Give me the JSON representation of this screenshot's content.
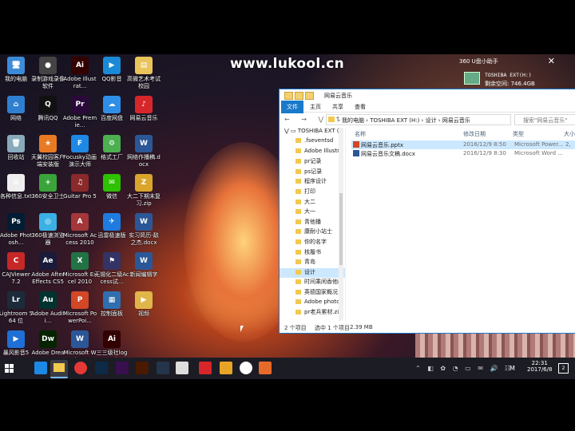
{
  "watermark": "www.lukool.cn",
  "notification": {
    "title": "360 U盘小助手",
    "close": "✕",
    "device": "TOSHIBA EXT(H:)",
    "space": "剩余空间: 746.4GB"
  },
  "desktop_icons": [
    {
      "label": "我的电脑",
      "color": "#3c8bd8",
      "glyph": "🖥"
    },
    {
      "label": "录制游戏录像软件",
      "color": "#444",
      "glyph": "●"
    },
    {
      "label": "Adobe Illustrat...",
      "color": "#330000",
      "glyph": "Ai"
    },
    {
      "label": "QQ影音",
      "color": "#1b8ad6",
      "glyph": "▶"
    },
    {
      "label": "高微艺术考试校园",
      "color": "#e8c45a",
      "glyph": "▤"
    },
    {
      "label": "网络",
      "color": "#2f7fd0",
      "glyph": "⌂"
    },
    {
      "label": "腾讯QQ",
      "color": "#111",
      "glyph": "Q"
    },
    {
      "label": "Adobe Premie...",
      "color": "#2a0a3a",
      "glyph": "Pr"
    },
    {
      "label": "百度网盘",
      "color": "#2f8ee8",
      "glyph": "☁"
    },
    {
      "label": "网易云音乐",
      "color": "#d7262a",
      "glyph": "♪"
    },
    {
      "label": "回收站",
      "color": "#8ab",
      "glyph": "🗑"
    },
    {
      "label": "天翼校园客户端安装版",
      "color": "#e97a24",
      "glyph": "★"
    },
    {
      "label": "Focusky动画演示大师",
      "color": "#1e88e5",
      "glyph": "F"
    },
    {
      "label": "格式工厂",
      "color": "#4caf50",
      "glyph": "⚙"
    },
    {
      "label": "网络作播稿.docx",
      "color": "#2b5797",
      "glyph": "W"
    },
    {
      "label": "各种信息.txt",
      "color": "#eee",
      "glyph": "≡"
    },
    {
      "label": "360安全卫士",
      "color": "#3aa33a",
      "glyph": "+"
    },
    {
      "label": "Guitar Pro 5",
      "color": "#8a2a2a",
      "glyph": "♫"
    },
    {
      "label": "微信",
      "color": "#2dc100",
      "glyph": "✉"
    },
    {
      "label": "大二下期末复习.zip",
      "color": "#d9a52b",
      "glyph": "Z"
    },
    {
      "label": "Adobe Photosh...",
      "color": "#001d34",
      "glyph": "Ps"
    },
    {
      "label": "360极速浏览器",
      "color": "#3bb0e4",
      "glyph": "◎"
    },
    {
      "label": "Microsoft Access 2010",
      "color": "#a4373a",
      "glyph": "A"
    },
    {
      "label": "迅雷极速版",
      "color": "#1e7be0",
      "glyph": "✈"
    },
    {
      "label": "实习简历-敌之杰.docx",
      "color": "#2b5797",
      "glyph": "W"
    },
    {
      "label": "CAJViewer 7.2",
      "color": "#c62828",
      "glyph": "C"
    },
    {
      "label": "Adobe After Effects CS5",
      "color": "#1a1a3a",
      "glyph": "Ae"
    },
    {
      "label": "Microsoft Excel 2010",
      "color": "#217346",
      "glyph": "X"
    },
    {
      "label": "无锡化二级Access试...",
      "color": "#336",
      "glyph": "⚑"
    },
    {
      "label": "新闻编辑字",
      "color": "#2b5797",
      "glyph": "W"
    },
    {
      "label": "Lightroom 5 64 位",
      "color": "#1c2b3a",
      "glyph": "Lr"
    },
    {
      "label": "Adobe Auditi...",
      "color": "#00332f",
      "glyph": "Au"
    },
    {
      "label": "Microsoft PowerPoi...",
      "color": "#d24726",
      "glyph": "P"
    },
    {
      "label": "控制面板",
      "color": "#2f6fb0",
      "glyph": "▦"
    },
    {
      "label": "视频",
      "color": "#e0b64a",
      "glyph": "▶"
    },
    {
      "label": "暴风影音5",
      "color": "#1e6fd6",
      "glyph": "▶"
    },
    {
      "label": "Adobe Dreamwe...",
      "color": "#072401",
      "glyph": "Dw"
    },
    {
      "label": "Microsoft Word 2010",
      "color": "#2b5797",
      "glyph": "W"
    },
    {
      "label": "三三级社logo.ai",
      "color": "#330000",
      "glyph": "Ai"
    }
  ],
  "explorer": {
    "title": "网易云音乐",
    "ribbon": {
      "file": "文件",
      "home": "主页",
      "share": "共享",
      "view": "查看"
    },
    "nav_arrows": "← → ⋁ ↑",
    "breadcrumb": "› 我的电脑 › TOSHIBA EXT (H:) › 设计 › 网易云音乐",
    "search_placeholder": "搜索\"网易云音乐\"",
    "nav_root": "TOSHIBA EXT (",
    "nav_items": [
      ".fseventsd",
      "Adobe Illustr",
      "pr记录",
      "ps记录",
      "程序设计",
      "打印",
      "大二",
      "大一",
      "青他播",
      "康耐小站士",
      "你的名字",
      "核履书",
      "青岛",
      "设计",
      "时间乘闲香他画",
      "英德国家概况",
      "Adobe photo",
      "pr老兵累材.zip"
    ],
    "selected_nav": "设计",
    "columns": {
      "name": "名称",
      "date": "修改日期",
      "type": "类型",
      "size": "大小"
    },
    "files": [
      {
        "name": "网易云音乐.pptx",
        "date": "2016/12/9 8:50",
        "type": "Microsoft Power...",
        "size": "2,",
        "color": "#d24726"
      },
      {
        "name": "网易云音乐文稿.docx",
        "date": "2016/12/9 8:30",
        "type": "Microsoft Word ...",
        "size": "",
        "color": "#2b5797"
      }
    ],
    "status": {
      "count": "2 个项目",
      "selected": "选中 1 个项目",
      "size": "2.39 MB"
    }
  },
  "taskbar": {
    "apps": [
      {
        "name": "edge",
        "color": "#1e88e5"
      },
      {
        "name": "explorer",
        "color": "#f1c94f",
        "active": true
      },
      {
        "name": "chrome-like",
        "color": "#e53935"
      },
      {
        "name": "photoshop",
        "color": "#0d2a47"
      },
      {
        "name": "premiere",
        "color": "#3a0f4f"
      },
      {
        "name": "illustrator",
        "color": "#4a1a00"
      },
      {
        "name": "lightroom",
        "color": "#24344a"
      },
      {
        "name": "qq",
        "color": "#ddd"
      },
      {
        "name": "netease-music",
        "color": "#d7262a"
      },
      {
        "name": "tianyi",
        "color": "#e8a427"
      },
      {
        "name": "white-app",
        "color": "#ffffff"
      },
      {
        "name": "focusky",
        "color": "#e86a2a"
      }
    ],
    "tray_icons": "⌃ ◧ ✿ ◔ ▭ ✉ 🔊 ☷",
    "lang": "M",
    "time": "22:31",
    "date": "2017/6/8",
    "notif_count": "2"
  }
}
